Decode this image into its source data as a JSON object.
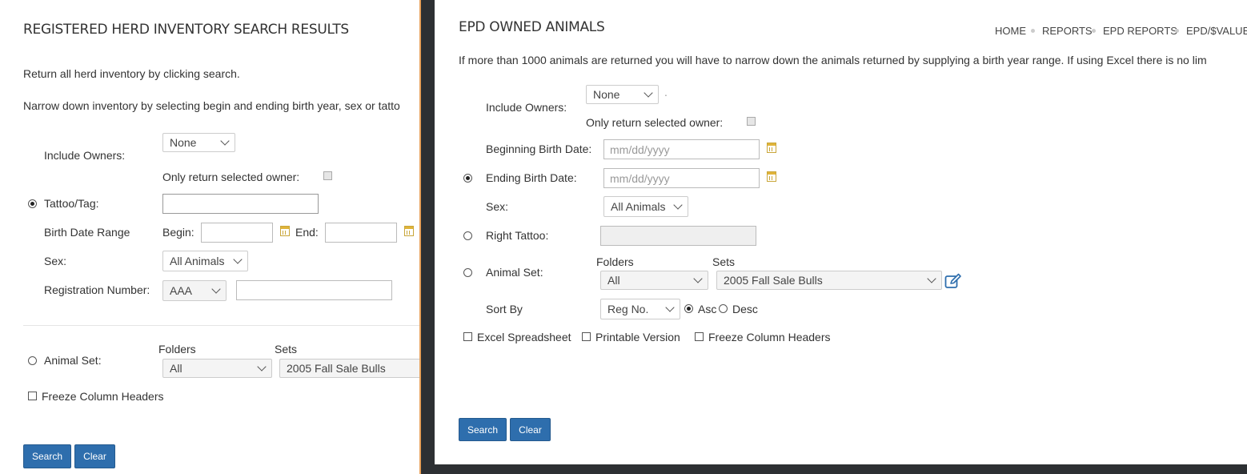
{
  "left": {
    "title": "REGISTERED HERD INVENTORY SEARCH RESULTS",
    "intro1": "Return all herd inventory by clicking search.",
    "intro2": "Narrow down inventory by selecting begin and ending birth year, sex or tatto",
    "include_owners_label": "Include Owners:",
    "include_owners_value": "None",
    "only_return_label": "Only return selected owner:",
    "tattoo_label": "Tattoo/Tag:",
    "birth_range_label": "Birth Date Range",
    "begin_label": "Begin:",
    "end_label": "End:",
    "sex_label": "Sex:",
    "sex_value": "All Animals",
    "reg_label": "Registration Number:",
    "reg_value": "AAA",
    "animal_set_label": "Animal Set:",
    "folders_label": "Folders",
    "sets_label": "Sets",
    "folders_value": "All",
    "sets_value": "2005 Fall Sale Bulls",
    "freeze_label": "Freeze Column Headers",
    "search_btn": "Search",
    "clear_btn": "Clear"
  },
  "right": {
    "title": "EPD OWNED ANIMALS",
    "breadcrumb": [
      "HOME",
      "REPORTS",
      "EPD REPORTS",
      "EPD/$VALUE"
    ],
    "notice": "If more than 1000 animals are returned you will have to narrow down the animals returned by supplying a birth year range. If using Excel there is no lim",
    "include_owners_label": "Include Owners:",
    "include_owners_value": "None",
    "include_owners_suffix": ".",
    "only_return_label": "Only return selected owner:",
    "begin_date_label": "Beginning Birth Date:",
    "begin_date_placeholder": "mm/dd/yyyy",
    "end_date_label": "Ending Birth Date:",
    "end_date_placeholder": "mm/dd/yyyy",
    "sex_label": "Sex:",
    "sex_value": "All Animals",
    "right_tattoo_label": "Right Tattoo:",
    "animal_set_label": "Animal Set:",
    "folders_label": "Folders",
    "sets_label": "Sets",
    "folders_value": "All",
    "sets_value": "2005 Fall Sale Bulls",
    "sort_label": "Sort By",
    "sort_value": "Reg No.",
    "asc_label": "Asc",
    "desc_label": "Desc",
    "excel_label": "Excel Spreadsheet",
    "printable_label": "Printable Version",
    "freeze_label": "Freeze Column Headers",
    "search_btn": "Search",
    "clear_btn": "Clear"
  },
  "colors": {
    "button": "#2e6ead",
    "overlay": "#2d3033",
    "overlay_edge": "#e8a15a"
  }
}
